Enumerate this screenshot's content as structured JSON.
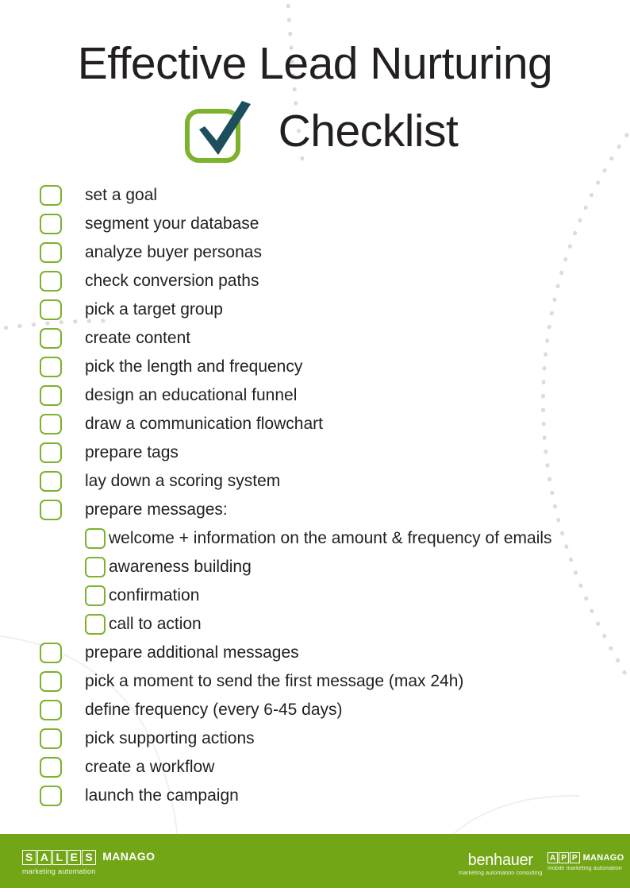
{
  "header": {
    "title_line1": "Effective Lead Nurturing",
    "title_line2": "Checklist",
    "tick_icon": "checkmark-box-icon",
    "tick_box_color": "#7cb22c",
    "tick_mark_color": "#1d4e5c"
  },
  "theme": {
    "accent_green": "#7cb22c",
    "footer_green": "#72a616",
    "text_color": "#231f20",
    "dot_color": "#dcdcdc"
  },
  "checklist": {
    "items": [
      {
        "label": "set a goal",
        "level": 0,
        "checked": false
      },
      {
        "label": "segment your database",
        "level": 0,
        "checked": false
      },
      {
        "label": "analyze buyer personas",
        "level": 0,
        "checked": false
      },
      {
        "label": "check conversion paths",
        "level": 0,
        "checked": false
      },
      {
        "label": "pick a target group",
        "level": 0,
        "checked": false
      },
      {
        "label": "create content",
        "level": 0,
        "checked": false
      },
      {
        "label": "pick the length and frequency",
        "level": 0,
        "checked": false
      },
      {
        "label": "design an educational funnel",
        "level": 0,
        "checked": false
      },
      {
        "label": "draw a communication flowchart",
        "level": 0,
        "checked": false
      },
      {
        "label": "prepare tags",
        "level": 0,
        "checked": false
      },
      {
        "label": "lay down a scoring system",
        "level": 0,
        "checked": false
      },
      {
        "label": "prepare messages:",
        "level": 0,
        "checked": false
      },
      {
        "label": "welcome + information on the amount & frequency of emails",
        "level": 1,
        "checked": false
      },
      {
        "label": "awareness building",
        "level": 1,
        "checked": false
      },
      {
        "label": "confirmation",
        "level": 1,
        "checked": false
      },
      {
        "label": "call to action",
        "level": 1,
        "checked": false
      },
      {
        "label": "prepare additional messages",
        "level": 0,
        "checked": false
      },
      {
        "label": "pick a moment to send the first message (max 24h)",
        "level": 0,
        "checked": false
      },
      {
        "label": "define frequency (every 6-45 days)",
        "level": 0,
        "checked": false
      },
      {
        "label": "pick supporting actions",
        "level": 0,
        "checked": false
      },
      {
        "label": "create a workflow",
        "level": 0,
        "checked": false
      },
      {
        "label": "launch the campaign",
        "level": 0,
        "checked": false
      }
    ]
  },
  "footer": {
    "salesmanago": {
      "letters": [
        "S",
        "A",
        "L",
        "E",
        "S"
      ],
      "word": "MANAGO",
      "tagline": "marketing automation"
    },
    "benhauer": {
      "name": "benhauer",
      "tagline": "marketing automation consulting"
    },
    "appmanago": {
      "letters": [
        "A",
        "P",
        "P"
      ],
      "word": "MANAGO",
      "tagline": "mobile marketing automation"
    }
  }
}
